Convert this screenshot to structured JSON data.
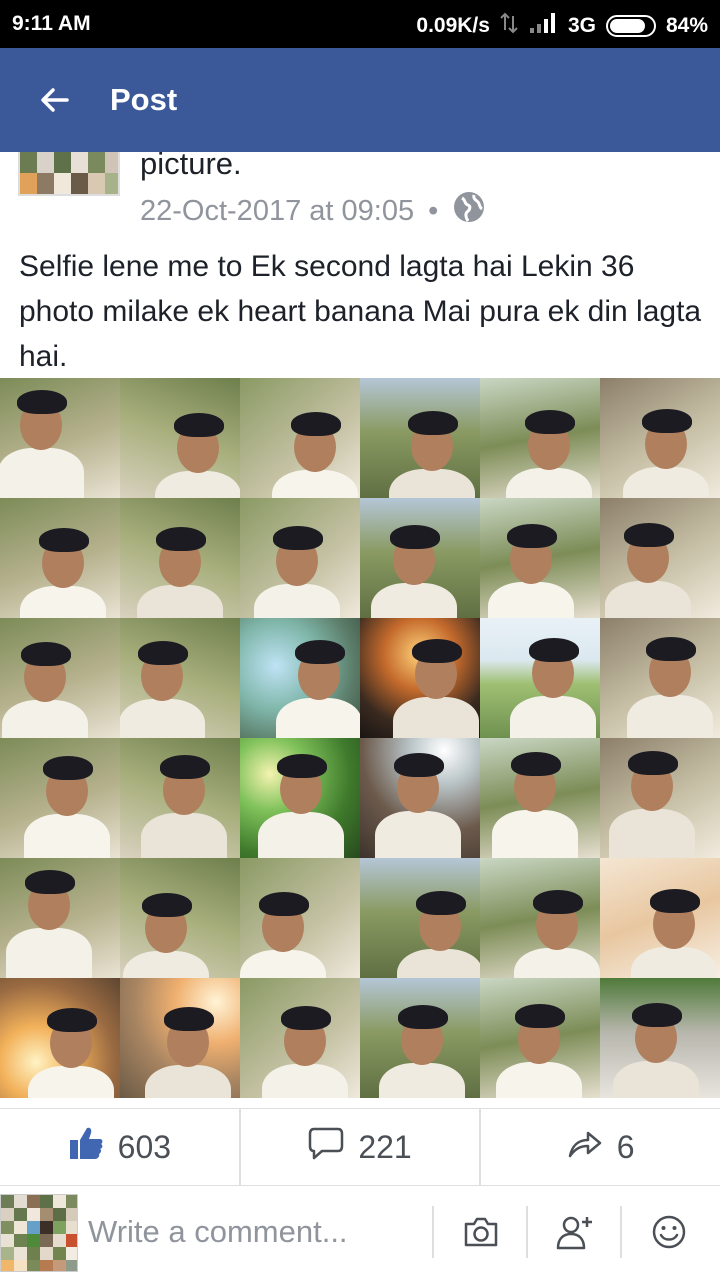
{
  "status": {
    "time": "9:11 AM",
    "speed": "0.09K/s",
    "network": "3G",
    "battery": "84%",
    "battery_level": 0.84
  },
  "appbar": {
    "title": "Post"
  },
  "post": {
    "header_text": "picture.",
    "timestamp": "22-Oct-2017 at 09:05",
    "separator": "•",
    "visibility_icon": "globe-icon",
    "body": "Selfie lene me to Ek second lagta hai Lekin 36 photo milake ek heart banana Mai pura ek din lagta hai."
  },
  "actions": {
    "likes": "603",
    "comments": "221",
    "shares": "6"
  },
  "comment_bar": {
    "placeholder": "Write a comment..."
  },
  "colors": {
    "brand": "#3b5998",
    "like_blue": "#4267b2",
    "meta_gray": "#90949c"
  }
}
